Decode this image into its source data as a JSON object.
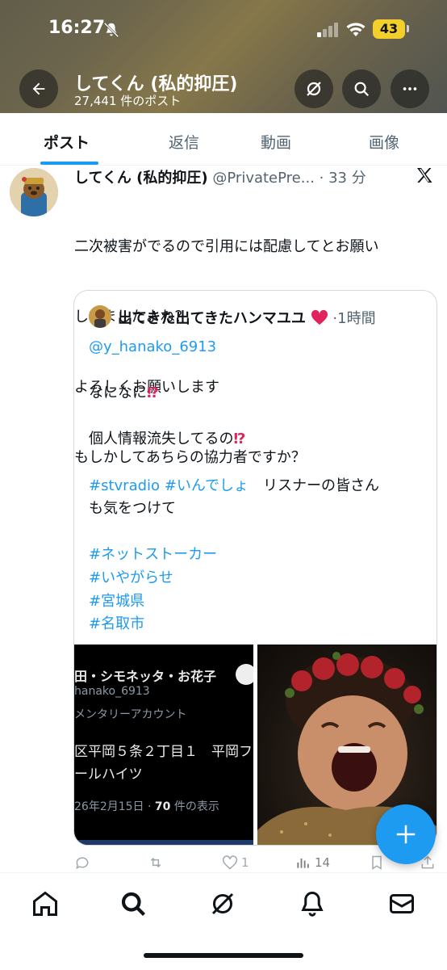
{
  "status_bar": {
    "time": "16:27",
    "battery": "43"
  },
  "header": {
    "name": "してくん (私的抑圧)",
    "post_count": "27,441 件のポスト"
  },
  "tabs": [
    {
      "label": "ポスト",
      "active": true
    },
    {
      "label": "返信",
      "active": false
    },
    {
      "label": "動画",
      "active": false
    },
    {
      "label": "画像",
      "active": false
    }
  ],
  "post": {
    "author_name": "してくん (私的抑圧)",
    "author_handle": "@PrivatePre...",
    "time": "· 33 分",
    "lines": [
      "二次被害がでるので引用には配慮してとお願い",
      "してましたよね？",
      "よろしくお願いします",
      "もしかしてあちらの協力者ですか？"
    ]
  },
  "quote": {
    "author_name": "出てきた出てきたハンマユユ",
    "time": "·1時間",
    "mention": "@y_hanako_6913",
    "line1": "なになに",
    "line2": "個人情報流失してるの",
    "hashtag1": "#stvradio",
    "hashtag2": "#いんでしょ",
    "text_after_tags": "リスナーの皆さん",
    "text_cont": "も気をつけて",
    "hashtags": [
      "#ネットストーカー",
      "#いやがらせ",
      "#宮城県",
      "#名取市"
    ],
    "emoji_exclaim": "⁉"
  },
  "media_left": {
    "name": "田・シモネッタ・お花子",
    "handle": "hanako_6913",
    "account_type": "メンタリーアカウント",
    "address1": "区平岡５条２丁目１　平岡フ",
    "address2": "ールハイツ",
    "date": "26年2月15日 · ",
    "views_count": "70",
    "views_label": " 件の表示"
  },
  "actions": {
    "likes": "1",
    "views": "14"
  },
  "colors": {
    "accent": "#1d9bf0",
    "heart": "#e0245e",
    "battery": "#f2cf2a"
  },
  "icons": [
    "back-arrow-icon",
    "grok-icon",
    "search-icon",
    "more-icon",
    "x-logo-icon",
    "heart-icon",
    "reply-icon",
    "repost-icon",
    "like-icon",
    "views-icon",
    "bookmark-icon",
    "share-icon",
    "plus-icon",
    "home-icon",
    "notifications-icon",
    "messages-icon"
  ]
}
